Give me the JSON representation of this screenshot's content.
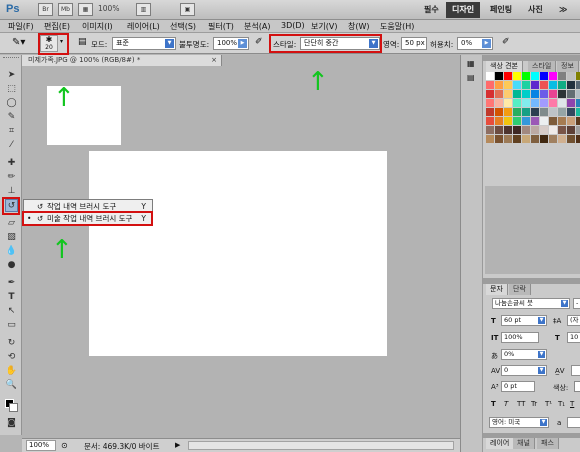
{
  "appbar": {
    "logo": "Ps",
    "zoom": "100%",
    "workspaces": [
      "필수",
      "디자인",
      "페인팅",
      "사진"
    ],
    "more": "≫"
  },
  "menubar": {
    "items": [
      "파일(F)",
      "편집(E)",
      "이미지(I)",
      "레이어(L)",
      "선택(S)",
      "필터(T)",
      "분석(A)",
      "3D(D)",
      "보기(V)",
      "창(W)",
      "도움말(H)"
    ]
  },
  "options": {
    "brush_size": "20",
    "mode_label": "모드:",
    "mode_value": "표준",
    "opacity_label": "불투명도:",
    "opacity_value": "100%",
    "style_label": "스타일:",
    "style_value": "단단히 중간",
    "area_label": "영역:",
    "area_value": "50 px",
    "tolerance_label": "허용치:",
    "tolerance_value": "0%"
  },
  "document": {
    "tab_title": "미제가족.JPG @ 100% (RGB/8#) *",
    "close": "×"
  },
  "flyout": {
    "items": [
      {
        "label": "작업 내역 브러시 도구",
        "key": "Y",
        "bullet": ""
      },
      {
        "label": "미술 작업 내역 브러시 도구",
        "key": "Y",
        "bullet": "•"
      }
    ]
  },
  "status": {
    "zoom": "100%",
    "doc_info": "문서: 469.3K/0 바이트"
  },
  "panels": {
    "top_tabs": [
      "색상 견본",
      "스타일",
      "정보"
    ],
    "mid_tabs": [
      "문자",
      "단락"
    ],
    "font_family": "나눔손글씨 붓",
    "font_size": "60 pt",
    "leading_short": "(자",
    "scale_v": "100%",
    "scale_h": "10",
    "tracking": "0%",
    "kerning": "0",
    "baseline": "0 pt",
    "color_label": "색상:",
    "type_styles": [
      "T",
      "T",
      "TT",
      "Tr",
      "T¹",
      "T₁",
      "T",
      "T"
    ],
    "language": "영어: 미국",
    "aa": "a",
    "bottom_tabs": [
      "레이어",
      "채널",
      "패스"
    ]
  },
  "swatch_colors": [
    "#ffffff",
    "#000000",
    "#ff0000",
    "#ffff00",
    "#00ff00",
    "#00ffff",
    "#0000ff",
    "#ff00ff",
    "#808080",
    "#c0c0c0",
    "#808000",
    "#ff6b6b",
    "#ff9f43",
    "#feca57",
    "#48dbfb",
    "#1dd1a1",
    "#5f27cd",
    "#ee5253",
    "#0abde3",
    "#10ac84",
    "#222f3e",
    "#576574",
    "#d63031",
    "#e17055",
    "#fdcb6e",
    "#00b894",
    "#00cec9",
    "#0984e3",
    "#6c5ce7",
    "#e84393",
    "#2d3436",
    "#636e72",
    "#b2bec3",
    "#ff7675",
    "#fab1a0",
    "#ffeaa7",
    "#55efc4",
    "#81ecec",
    "#74b9ff",
    "#a29bfe",
    "#fd79a8",
    "#dfe6e9",
    "#8e44ad",
    "#2980b9",
    "#c0392b",
    "#d35400",
    "#f39c12",
    "#27ae60",
    "#16a085",
    "#2c3e50",
    "#7f8c8d",
    "#bdc3c7",
    "#95a5a6",
    "#34495e",
    "#1abc9c",
    "#e74c3c",
    "#e67e22",
    "#f1c40f",
    "#2ecc71",
    "#3498db",
    "#9b59b6",
    "#ecf0f1",
    "#7d5c3b",
    "#a67c52",
    "#c9a07a",
    "#5b3a1e",
    "#8d6e63",
    "#6d4c41",
    "#4e342e",
    "#3e2723",
    "#a1887f",
    "#bcaaa4",
    "#d7ccc8",
    "#efebe9",
    "#795548",
    "#5d4037",
    "#9e9e9e",
    "#b58a5c",
    "#7a5230",
    "#9c7a56",
    "#604020",
    "#c8a878",
    "#806040",
    "#402810",
    "#a08060",
    "#d0b090",
    "#705030",
    "#503018"
  ],
  "colors": {
    "annotation_red": "#d31010",
    "annotation_green": "#12c51f"
  }
}
